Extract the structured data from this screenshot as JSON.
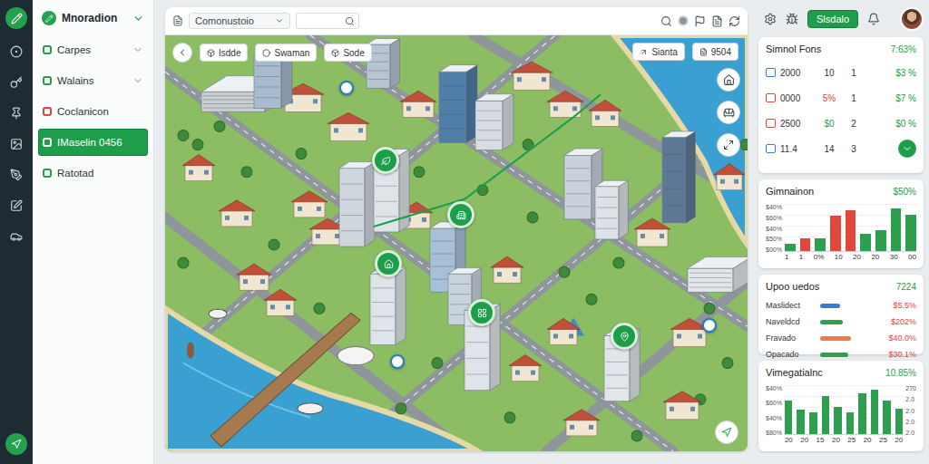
{
  "sidebar": {
    "title": "Mnoradion",
    "items": [
      {
        "label": "Carpes",
        "expandable": true,
        "selected": false,
        "color": "#2a9d4b"
      },
      {
        "label": "Walains",
        "expandable": true,
        "selected": false,
        "color": "#2a9d4b"
      },
      {
        "label": "Coclanicon",
        "expandable": false,
        "selected": false,
        "color": "#d9443a"
      },
      {
        "label": "IMaselin 0456",
        "expandable": false,
        "selected": true,
        "color": "#ffffff"
      },
      {
        "label": "Ratotad",
        "expandable": false,
        "selected": false,
        "color": "#2a9d4b"
      }
    ]
  },
  "toolbar": {
    "select": "Comonustoio"
  },
  "map": {
    "chips": [
      "Isdde",
      "Swaman",
      "Sode"
    ],
    "right_chips": [
      "Sianta",
      "9504"
    ]
  },
  "header": {
    "button": "Slsdalo"
  },
  "stats": {
    "title": "Simnol Fons",
    "value": "7:63%",
    "rows": [
      {
        "kind": "text",
        "amount": "2000",
        "count": "10",
        "qty": "1",
        "rate": "$3 %",
        "icon_color": "#3a7bd5",
        "count_color": "#333333"
      },
      {
        "kind": "text",
        "amount": "0000",
        "count": "5%",
        "qty": "1",
        "rate": "$7 %",
        "icon_color": "#d9443a",
        "count_color": "#d9443a"
      },
      {
        "kind": "text",
        "amount": "2500",
        "count": "$0",
        "qty": "2",
        "rate": "$0 %",
        "icon_color": "#d9443a",
        "count_color": "#2a9d4b"
      },
      {
        "kind": "button",
        "amount": "11.4",
        "count": "14",
        "qty": "3",
        "rate": "",
        "icon_color": "#3a7bd5",
        "count_color": "#333333"
      }
    ]
  },
  "chart1": {
    "title": "Gimnainon",
    "value": "$50%",
    "y_ticks": [
      "$40%",
      "$60%",
      "$40%",
      "$50%",
      "$00%"
    ],
    "x_ticks": [
      "1",
      "1",
      "0%",
      "10",
      "20",
      "20",
      "30",
      "00"
    ],
    "max": 80,
    "bars": [
      {
        "value": 12,
        "color": "#2e9e4f"
      },
      {
        "value": 22,
        "color": "#e0483c"
      },
      {
        "value": 22,
        "color": "#2e9e4f"
      },
      {
        "value": 60,
        "color": "#e0483c"
      },
      {
        "value": 70,
        "color": "#e0483c"
      },
      {
        "value": 30,
        "color": "#2e9e4f"
      },
      {
        "value": 35,
        "color": "#2e9e4f"
      },
      {
        "value": 72,
        "color": "#2e9e4f"
      },
      {
        "value": 62,
        "color": "#2e9e4f"
      }
    ]
  },
  "updates": {
    "title": "Upoo uedos",
    "value": "7224",
    "rows": [
      {
        "label": "Maslidect",
        "level": 0.35,
        "reading": "$5.5%",
        "color": "#3a7bd5"
      },
      {
        "label": "Naveldcd",
        "level": 0.4,
        "reading": "$202%",
        "color": "#2e9e4f"
      },
      {
        "label": "Fravado",
        "level": 0.55,
        "reading": "$40.0%",
        "color": "#ef7a4a"
      },
      {
        "label": "Opacado",
        "level": 0.5,
        "reading": "$30.1%",
        "color": "#2e9e4f"
      }
    ]
  },
  "chart2": {
    "title": "Vimegatialnc",
    "value": "10.85%",
    "y_ticks": [
      "$40%",
      "$60%",
      "$40%",
      "$80%"
    ],
    "y_ticks_right": [
      "270",
      "2.0",
      "2.0",
      "2.0",
      "2.0"
    ],
    "x_ticks": [
      "20",
      "20",
      "15",
      "20",
      "25",
      "20",
      "25",
      "20"
    ],
    "max": 80,
    "bars": [
      55,
      40,
      35,
      62,
      45,
      35,
      66,
      72,
      55,
      42
    ]
  }
}
